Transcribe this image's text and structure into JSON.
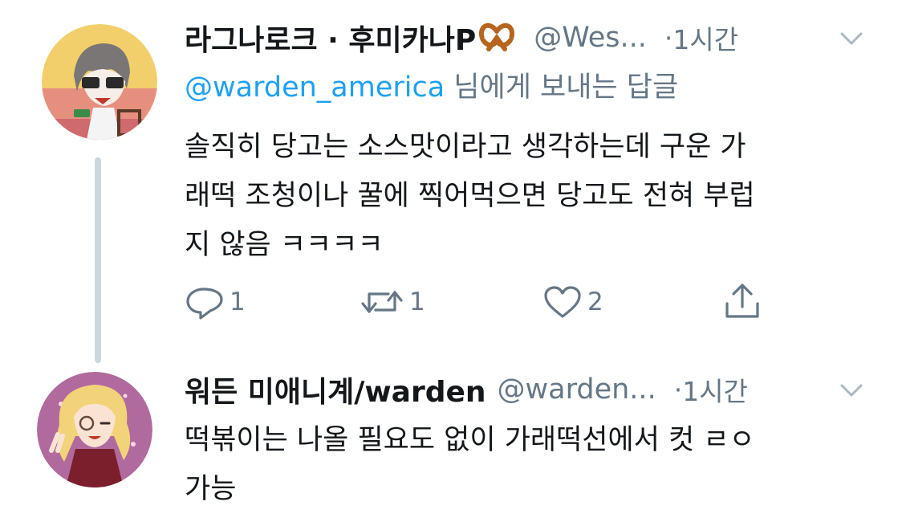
{
  "tweets": [
    {
      "display_name": "라그나로크 · 후미카나P",
      "name_emoji": "pretzel-emoji",
      "handle": "@Wes...",
      "separator": "·",
      "time": "1시간",
      "reply_mention": "@warden_america",
      "reply_suffix": " 님에게 보내는 답글",
      "text_lines": [
        "솔직히 당고는 소스맛이라고 생각하는데 구운 가",
        "래떡 조청이나 꿀에 찍어먹으면 당고도 전혀 부럽",
        "지 않음 ㅋㅋㅋㅋ"
      ],
      "actions": {
        "replies": "1",
        "retweets": "1",
        "likes": "2"
      }
    },
    {
      "display_name": "워든 미애니계/warden",
      "handle": "@warden...",
      "separator": "·",
      "time": "1시간",
      "text_lines": [
        "떡볶이는 나올 필요도 없이 가래떡선에서 컷 ㄹㅇ",
        "가능"
      ]
    }
  ],
  "colors": {
    "link": "#1da1f2",
    "secondary_text": "#657786",
    "primary_text": "#14171a",
    "thread_line": "#ccd6dd"
  },
  "icons": [
    "reply-icon",
    "retweet-icon",
    "like-icon",
    "share-icon",
    "chevron-down-icon"
  ]
}
